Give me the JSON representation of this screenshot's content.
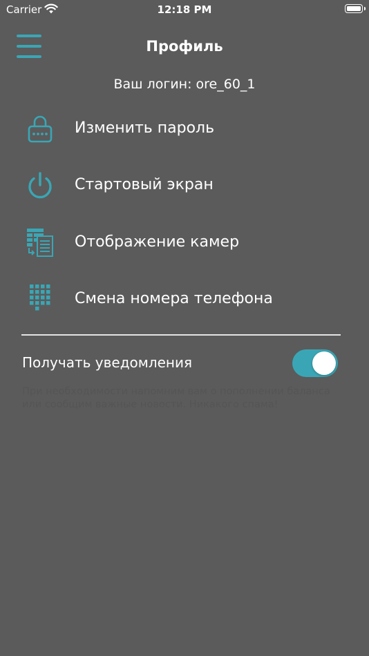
{
  "status_bar": {
    "carrier": "Carrier",
    "time": "12:18 PM"
  },
  "header": {
    "title": "Профиль"
  },
  "login_text": "Ваш логин: ore_60_1",
  "menu": [
    {
      "label": "Изменить пароль",
      "icon": "lock-icon"
    },
    {
      "label": "Стартовый экран",
      "icon": "power-icon"
    },
    {
      "label": "Отображение камер",
      "icon": "camera-list-icon"
    },
    {
      "label": "Смена номера телефона",
      "icon": "keypad-icon"
    }
  ],
  "notifications": {
    "label": "Получать уведомления",
    "enabled": true,
    "description": "При необходимости напомним вам о пополнении баланса или сообщим важные новости. Никакого спама!"
  },
  "colors": {
    "background": "#5b5b5b",
    "accent": "#3aa6b5",
    "text": "#ffffff"
  }
}
